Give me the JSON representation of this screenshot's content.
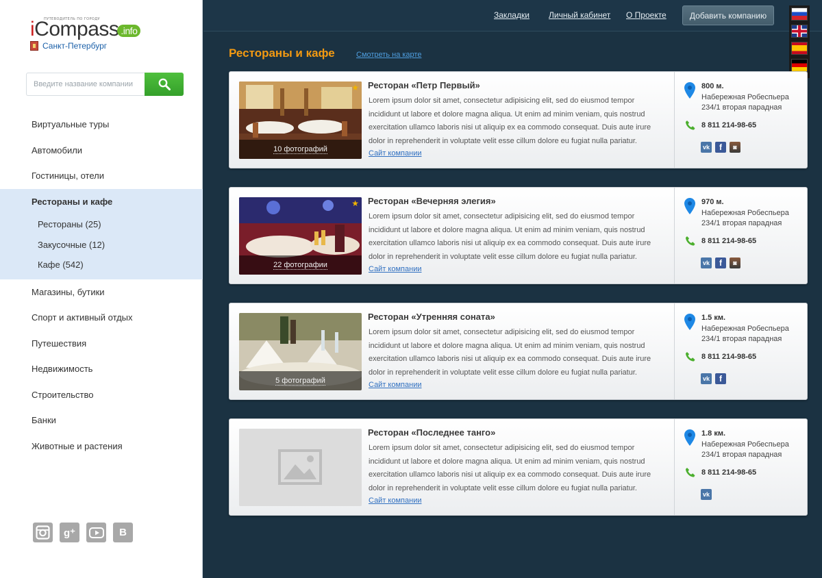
{
  "logo": {
    "tagline": "ПУТЕВОДИТЕЛЬ ПО ГОРОДУ",
    "name_i": "i",
    "name_rest": "Compass",
    "badge": ".info"
  },
  "city": "Санкт-Петербург",
  "search": {
    "placeholder": "Введите название компании"
  },
  "nav": {
    "items_top": [
      {
        "label": "Виртуальные туры"
      },
      {
        "label": "Автомобили"
      },
      {
        "label": "Гостиницы, отели"
      }
    ],
    "active": {
      "label": "Рестораны и кафе",
      "children": [
        {
          "label": "Рестораны (25)"
        },
        {
          "label": "Закусочные (12)"
        },
        {
          "label": "Кафе (542)"
        }
      ]
    },
    "items_bottom": [
      {
        "label": "Магазины, бутики"
      },
      {
        "label": "Спорт и активный отдых"
      },
      {
        "label": "Путешествия"
      },
      {
        "label": "Недвижимость"
      },
      {
        "label": "Строительство"
      },
      {
        "label": "Банки"
      },
      {
        "label": "Животные и растения"
      }
    ]
  },
  "footer_social": [
    "instagram-icon",
    "google-plus-icon",
    "youtube-icon",
    "vk-icon"
  ],
  "header": {
    "links": [
      "Закладки",
      "Личный кабинет",
      "О Проекте"
    ],
    "add_button": "Добавить компанию",
    "flags": [
      "ru",
      "uk",
      "es",
      "de"
    ]
  },
  "page": {
    "title": "Рестораны и кафе",
    "map_link": "Смотреть на карте"
  },
  "site_link_label": "Сайт компании",
  "description": "Lorem ipsum dolor sit amet, consectetur adipisicing elit, sed do eiusmod tempor incididunt ut labore et dolore magna aliqua. Ut enim ad minim veniam, quis nostrud exercitation ullamco laboris nisi ut aliquip ex ea commodo consequat. Duis aute irure dolor in reprehenderit in voluptate velit esse cillum dolore eu fugiat nulla pariatur.",
  "listings": [
    {
      "title": "Ресторан «Петр Первый»",
      "photos": "10 фотографий",
      "starred": true,
      "distance": "800 м.",
      "address": "Набережная Робеспьера 234/1 вторая парадная",
      "phone": "8 811 214-98-65",
      "social": [
        "vk",
        "fb",
        "ig"
      ]
    },
    {
      "title": "Ресторан «Вечерняя элегия»",
      "photos": "22 фотографии",
      "starred": true,
      "distance": "970 м.",
      "address": "Набережная Робеспьера 234/1 вторая парадная",
      "phone": "8 811 214-98-65",
      "social": [
        "vk",
        "fb",
        "ig"
      ]
    },
    {
      "title": "Ресторан «Утренняя соната»",
      "photos": "5 фотографий",
      "starred": false,
      "distance": "1.5 км.",
      "address": "Набережная Робеспьера 234/1 вторая парадная",
      "phone": "8 811 214-98-65",
      "social": [
        "vk",
        "fb"
      ]
    },
    {
      "title": "Ресторан «Последнее танго»",
      "photos": "",
      "starred": false,
      "distance": "1.8 км.",
      "address": "Набережная Робеспьера 234/1 вторая парадная",
      "phone": "8 811 214-98-65",
      "social": [
        "vk"
      ]
    }
  ],
  "colors": {
    "accent_orange": "#f39a12",
    "link_blue": "#2f6fc0",
    "search_green": "#3aa82e",
    "bg_dark": "#1b3242",
    "nav_active_bg": "#dbe8f7"
  }
}
